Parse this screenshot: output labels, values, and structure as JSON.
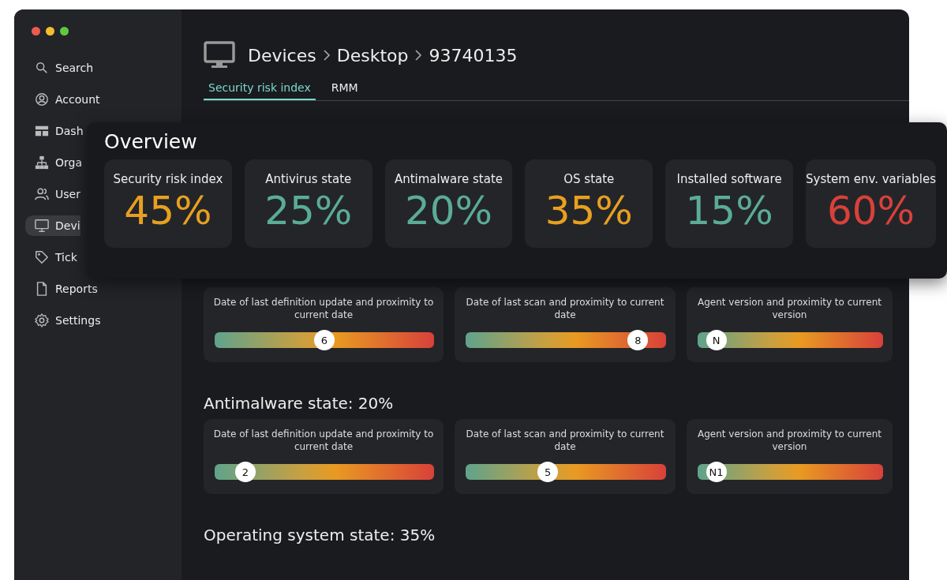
{
  "sidebar": {
    "items": [
      {
        "label": "Search",
        "selected": false
      },
      {
        "label": "Account",
        "selected": false
      },
      {
        "label": "Dash",
        "selected": false
      },
      {
        "label": "Orga",
        "selected": false
      },
      {
        "label": "User",
        "selected": false
      },
      {
        "label": "Devi",
        "selected": true
      },
      {
        "label": "Tick",
        "selected": false
      },
      {
        "label": "Reports",
        "selected": false
      },
      {
        "label": "Settings",
        "selected": false
      }
    ]
  },
  "breadcrumb": [
    "Devices",
    "Desktop",
    "93740135"
  ],
  "tabs": [
    {
      "label": "Security risk index",
      "selected": true
    },
    {
      "label": "RMM",
      "selected": false
    }
  ],
  "overview": {
    "title": "Overview",
    "cards": [
      {
        "label": "Security risk index",
        "value": "45%",
        "color": "#e8a020"
      },
      {
        "label": "Antivirus state",
        "value": "25%",
        "color": "#5aac96"
      },
      {
        "label": "Antimalware state",
        "value": "20%",
        "color": "#5aac96"
      },
      {
        "label": "OS state",
        "value": "35%",
        "color": "#e8a020"
      },
      {
        "label": "Installed software",
        "value": "15%",
        "color": "#5aac96"
      },
      {
        "label": "System env. variables",
        "value": "60%",
        "color": "#d8413a"
      }
    ]
  },
  "sections": [
    {
      "cards": [
        {
          "label": "Date of last definition update and proximity to current date",
          "level": 0.5,
          "marker": "6"
        },
        {
          "label": "Date of last scan and proximity to current date",
          "level": 0.86,
          "marker": "8"
        },
        {
          "label": "Agent version and proximity to current version",
          "level": 0.1,
          "marker": "N"
        }
      ]
    },
    {
      "title": "Antimalware state: 20%",
      "cards": [
        {
          "label": "Date of last definition update and proximity to current date",
          "level": 0.14,
          "marker": "2"
        },
        {
          "label": "Date of last scan and proximity to current date",
          "level": 0.41,
          "marker": "5"
        },
        {
          "label": "Agent version and proximity to current version",
          "level": 0.1,
          "marker": "N1"
        }
      ]
    },
    {
      "title": "Operating system state: 35%"
    }
  ]
}
